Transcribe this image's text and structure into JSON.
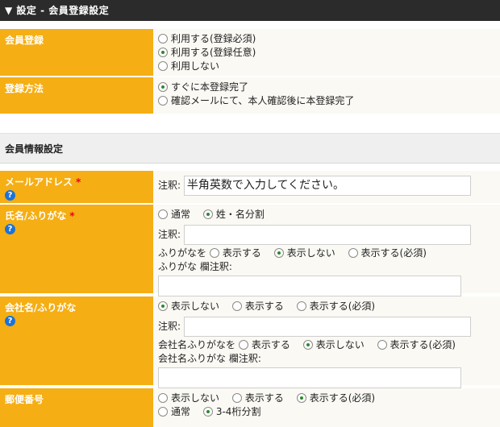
{
  "title": "▼ 設定 - 会員登録設定",
  "membership": {
    "label": "会員登録",
    "options": [
      "利用する(登録必須)",
      "利用する(登録任意)",
      "利用しない"
    ]
  },
  "registration_method": {
    "label": "登録方法",
    "options": [
      "すぐに本登録完了",
      "確認メールにて、本人確認後に本登録完了"
    ]
  },
  "section_title": "会員情報設定",
  "email": {
    "label": "メールアドレス",
    "note_label": "注釈:",
    "note_value": "半角英数で入力してください。"
  },
  "name": {
    "label": "氏名/ふりがな",
    "split_options": [
      "通常",
      "姓・名分割"
    ],
    "note_label": "注釈:",
    "furigana_prefix": "ふりがなを",
    "furigana_options": [
      "表示する",
      "表示しない",
      "表示する(必須)"
    ],
    "furigana_note_label": "ふりがな 欄注釈:"
  },
  "company": {
    "label": "会社名/ふりがな",
    "display_options": [
      "表示しない",
      "表示する",
      "表示する(必須)"
    ],
    "note_label": "注釈:",
    "furigana_prefix": "会社名ふりがなを",
    "furigana_options": [
      "表示する",
      "表示しない",
      "表示する(必須)"
    ],
    "furigana_note_label": "会社名ふりがな 欄注釈:"
  },
  "postal": {
    "label": "郵便番号",
    "display_options": [
      "表示しない",
      "表示する",
      "表示する(必須)"
    ],
    "split_options": [
      "通常",
      "3-4桁分割"
    ]
  },
  "required_mark": "*",
  "help_icon_glyph": "?"
}
